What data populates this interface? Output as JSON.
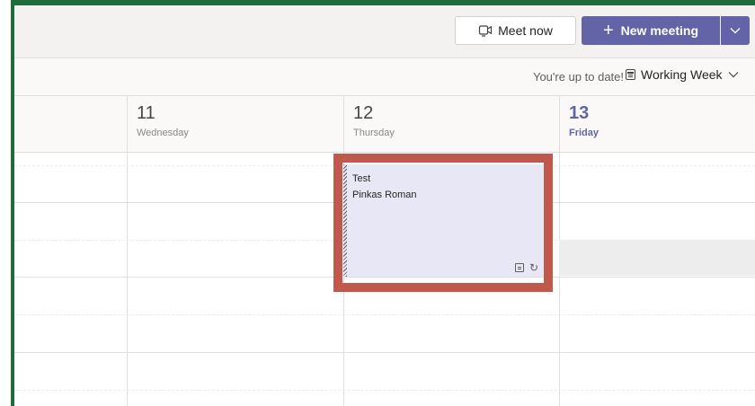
{
  "toolbar": {
    "meet_now_label": "Meet now",
    "new_meeting_label": "New meeting"
  },
  "status": {
    "up_to_date": "You're up to date!",
    "view_label": "Working Week"
  },
  "days": [
    {
      "number": "11",
      "name": "Wednesday"
    },
    {
      "number": "12",
      "name": "Thursday"
    },
    {
      "number": "13",
      "name": "Friday"
    }
  ],
  "event": {
    "title": "Test",
    "organizer": "Pinkas Roman"
  },
  "colors": {
    "accent": "#6264a7",
    "frame": "#1e6b3c",
    "highlight": "#c0594c",
    "event_bg": "#e8e7f6"
  }
}
